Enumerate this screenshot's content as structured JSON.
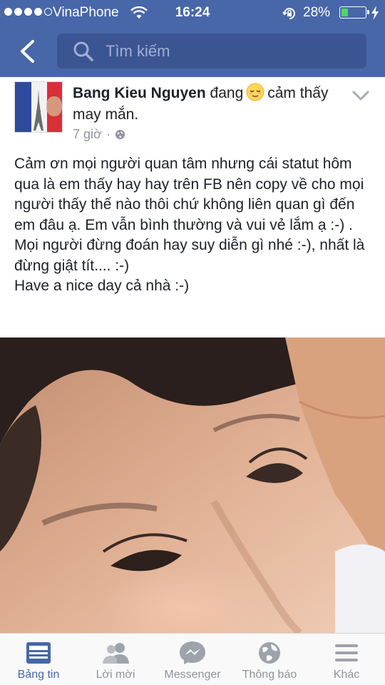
{
  "status_bar": {
    "carrier": "VinaPhone",
    "time": "16:24",
    "battery_percent": "28%",
    "battery_level": 0.28,
    "signal_bars_filled": 4,
    "signal_bars_total": 5
  },
  "nav": {
    "back_icon": "chevron-left-icon",
    "search_icon": "search-icon",
    "search_placeholder": "Tìm kiếm"
  },
  "post": {
    "author": "Bang Kieu Nguyen",
    "feeling_prefix": "đang",
    "feeling_emoji": "relieved-face",
    "feeling_suffix": "cảm thấy may mắn.",
    "time": "7 giờ",
    "separator": "·",
    "privacy_icon": "globe-icon",
    "text": "Cảm ơn mọi người quan tâm nhưng cái statut hôm qua là em thấy hay hay trên FB nên copy về cho mọi người thấy thế nào thôi chứ không liên quan gì đến em đâu ạ. Em vẫn bình thường và vui vẻ lắm ạ :-) . Mọi người đừng đoán hay suy diễn gì nhé :-), nhất là đừng giật tít.... :-)\nHave a nice day cả nhà :-)"
  },
  "tabs": [
    {
      "label": "Bảng tin",
      "icon": "news-feed-icon",
      "active": true
    },
    {
      "label": "Lời mời",
      "icon": "friend-requests-icon",
      "active": false
    },
    {
      "label": "Messenger",
      "icon": "messenger-icon",
      "active": false
    },
    {
      "label": "Thông báo",
      "icon": "globe-notifications-icon",
      "active": false
    },
    {
      "label": "Khác",
      "icon": "menu-icon",
      "active": false
    }
  ],
  "colors": {
    "brand_blue": "#4867a9",
    "search_bg": "#3b5592",
    "battery_green": "#4cd964",
    "muted_text": "#90949c"
  }
}
